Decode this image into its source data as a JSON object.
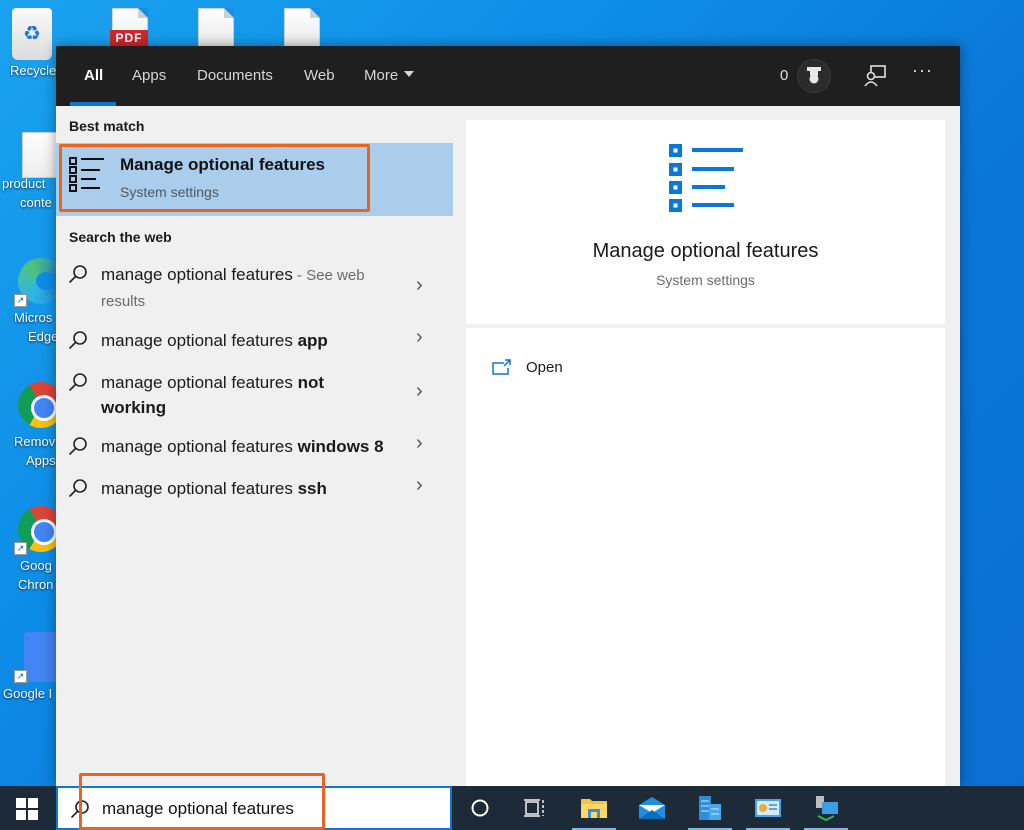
{
  "desktop": {
    "icons": [
      {
        "label": "Recycle Bin",
        "visible_label": "Recycle"
      },
      {
        "label": "PDF file",
        "badge": "PDF"
      },
      {
        "label": "product conte",
        "line1": "product",
        "line2": "conte"
      },
      {
        "label": "Microsoft Edge",
        "line1": "Micros",
        "line2": "Edge"
      },
      {
        "label": "Remove Apps",
        "line1": "Remov",
        "line2": "Apps"
      },
      {
        "label": "Google Chrome",
        "line1": "Goog",
        "line2": "Chron"
      },
      {
        "label": "Google Docs",
        "line1": "Google I"
      }
    ]
  },
  "search": {
    "tabs": [
      {
        "label": "All",
        "active": true
      },
      {
        "label": "Apps"
      },
      {
        "label": "Documents"
      },
      {
        "label": "Web"
      },
      {
        "label": "More"
      }
    ],
    "rewards_points": "0",
    "best_match_heading": "Best match",
    "best_match": {
      "title": "Manage optional features",
      "subtitle": "System settings"
    },
    "web_heading": "Search the web",
    "web_results": [
      {
        "prefix": "manage optional features",
        "bold": "",
        "suffix": " - See web results"
      },
      {
        "prefix": "manage optional features ",
        "bold": "app",
        "suffix": ""
      },
      {
        "prefix": "manage optional features ",
        "bold": "not working",
        "suffix": ""
      },
      {
        "prefix": "manage optional features ",
        "bold": "windows 8",
        "suffix": ""
      },
      {
        "prefix": "manage optional features ",
        "bold": "ssh",
        "suffix": ""
      }
    ],
    "preview": {
      "title": "Manage optional features",
      "subtitle": "System settings",
      "actions": [
        {
          "label": "Open"
        }
      ]
    },
    "query": "manage optional features"
  },
  "taskbar": {
    "items": [
      "Cortana",
      "Task View",
      "File Explorer",
      "Mail",
      "Server Manager",
      "Control Panel",
      "Network"
    ]
  },
  "colors": {
    "accent": "#0a78d7",
    "highlight_annotation": "#e8641f",
    "best_match_bg": "#a9cdeb",
    "topbar_bg": "#1f1f1f",
    "taskbar_bg": "#1d2a38"
  }
}
